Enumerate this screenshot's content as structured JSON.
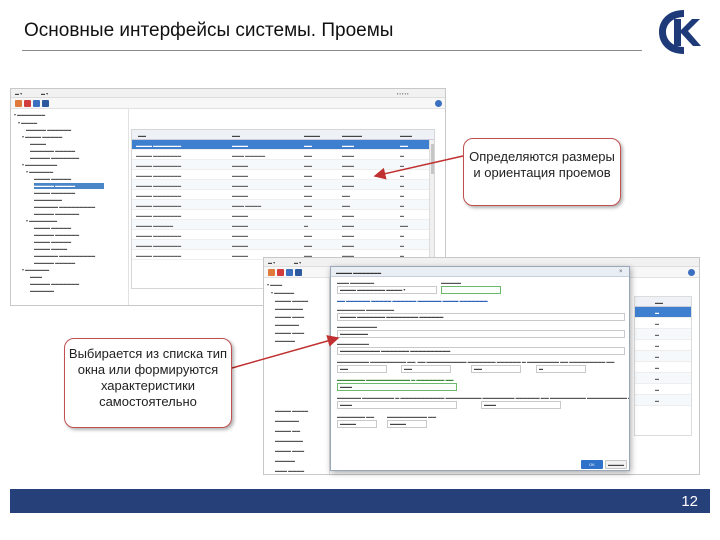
{
  "slide": {
    "title": "Основные интерфейсы системы. Проемы",
    "page_number": "12",
    "accent_color": "#26407a",
    "logo_icon": "ck-logo-icon"
  },
  "callouts": {
    "top_right": "Определяются размеры и ориентация проемов",
    "bottom_left": "Выбирается из списка тип окна или формируются характеристики самостоятельно"
  },
  "dialog": {
    "ok_label": "OK"
  }
}
